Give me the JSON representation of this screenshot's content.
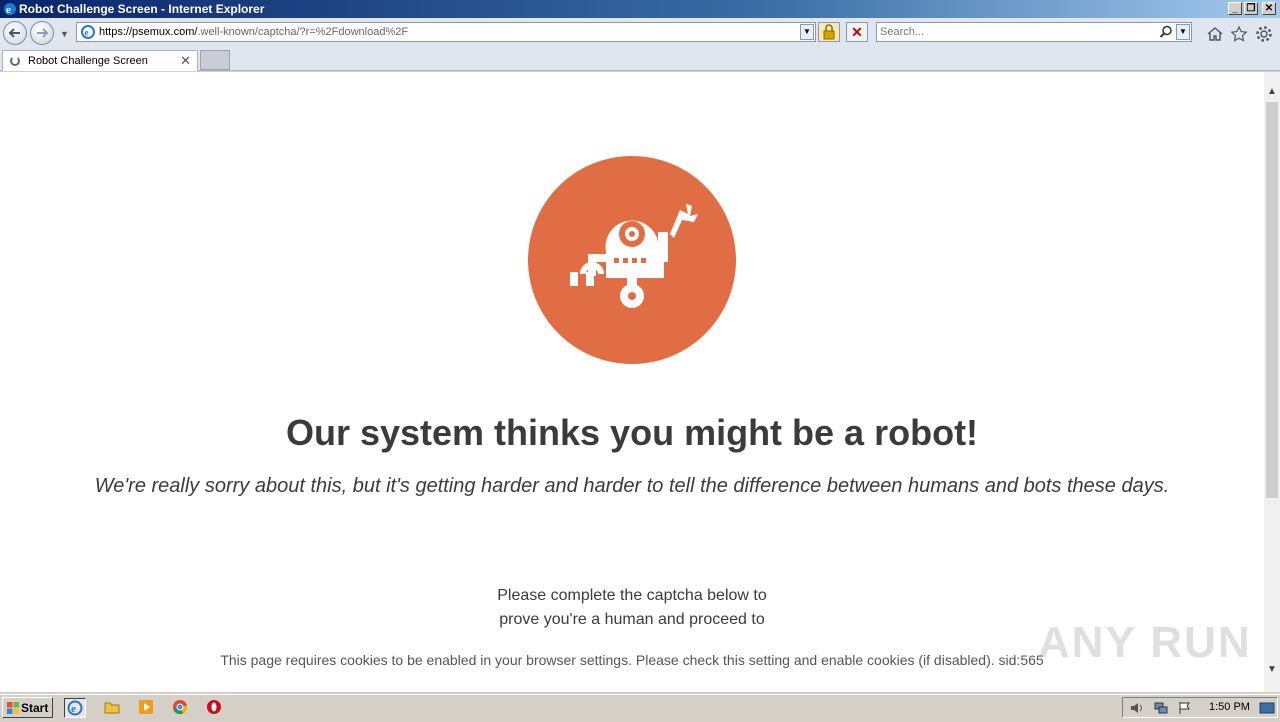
{
  "window": {
    "title": "Robot Challenge Screen - Internet Explorer",
    "minimize": "_",
    "restore": "❐",
    "close": "✕"
  },
  "nav": {
    "url_host": "https://psemux.com/",
    "url_path": ".well-known/captcha/?r=%2Fdownload%2F",
    "search_placeholder": "Search..."
  },
  "tabs": [
    {
      "label": "Robot Challenge Screen",
      "close": "✕"
    }
  ],
  "page": {
    "heading": "Our system thinks you might be a robot!",
    "subheading": "We're really sorry about this, but it's getting harder and harder to tell the difference between humans and bots these days.",
    "instruction_line1": "Please complete the captcha below to",
    "instruction_line2": "prove you're a human and proceed to",
    "cookie_notice": "This page requires cookies to be enabled in your browser settings. Please check this setting and enable cookies (if disabled). sid:565",
    "robot_color": "#e06d44"
  },
  "watermark": {
    "text": "ANY RUN"
  },
  "taskbar": {
    "start_label": "Start",
    "clock": "1:50 PM"
  }
}
